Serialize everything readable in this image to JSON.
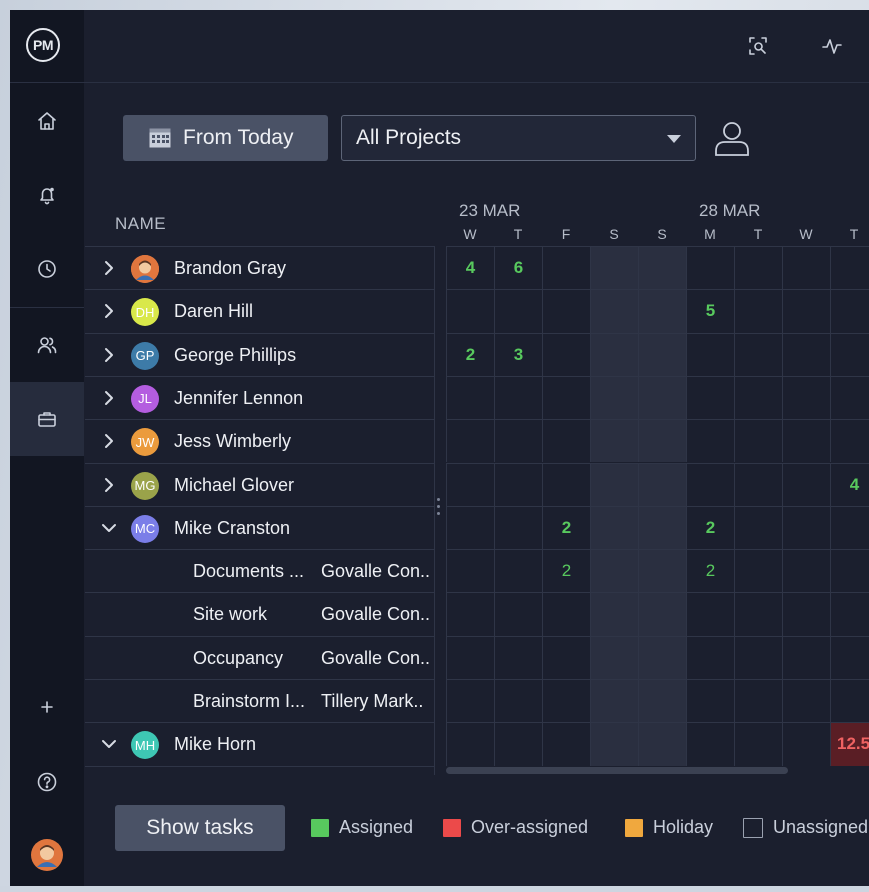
{
  "app": {
    "logo": "PM"
  },
  "sidebar": {
    "items": [
      {
        "icon": "home-icon"
      },
      {
        "icon": "bell-icon"
      },
      {
        "icon": "clock-icon"
      },
      {
        "icon": "users-icon"
      },
      {
        "icon": "briefcase-icon",
        "active": true
      },
      {
        "icon": "plus-icon"
      },
      {
        "icon": "help-icon"
      },
      {
        "icon": "avatar"
      }
    ]
  },
  "topbar": {
    "icons": [
      "zoom-search-icon",
      "activity-icon"
    ]
  },
  "toolbar": {
    "date_button": "From Today",
    "project_select": "All Projects"
  },
  "table": {
    "name_header": "NAME",
    "date_groups": [
      {
        "label": "23 MAR"
      },
      {
        "label": "28 MAR"
      }
    ],
    "days": [
      "W",
      "T",
      "F",
      "S",
      "S",
      "M",
      "T",
      "W",
      "T"
    ]
  },
  "people": [
    {
      "name": "Brandon Gray",
      "initials": "",
      "color": "#e0763e",
      "expanded": false,
      "cells": [
        "4",
        "6",
        "",
        "",
        "",
        "",
        "",
        "",
        ""
      ]
    },
    {
      "name": "Daren Hill",
      "initials": "DH",
      "color": "#d9e84a",
      "expanded": false,
      "cells": [
        "",
        "",
        "",
        "",
        "",
        "5",
        "",
        "",
        ""
      ]
    },
    {
      "name": "George Phillips",
      "initials": "GP",
      "color": "#3d7ba8",
      "expanded": false,
      "cells": [
        "2",
        "3",
        "",
        "",
        "",
        "",
        "",
        "",
        ""
      ]
    },
    {
      "name": "Jennifer Lennon",
      "initials": "JL",
      "color": "#b45de0",
      "expanded": false,
      "cells": [
        "",
        "",
        "",
        "",
        "",
        "",
        "",
        "",
        ""
      ]
    },
    {
      "name": "Jess Wimberly",
      "initials": "JW",
      "color": "#eb9b3d",
      "expanded": false,
      "cells": [
        "",
        "",
        "",
        "",
        "",
        "",
        "",
        "",
        ""
      ]
    },
    {
      "name": "Michael Glover",
      "initials": "MG",
      "color": "#9aa34a",
      "expanded": false,
      "cells": [
        "",
        "",
        "",
        "",
        "",
        "",
        "",
        "",
        "4"
      ]
    },
    {
      "name": "Mike Cranston",
      "initials": "MC",
      "color": "#7b7ee8",
      "expanded": true,
      "cells": [
        "",
        "",
        "2",
        "",
        "",
        "2",
        "",
        "",
        ""
      ]
    }
  ],
  "tasks": [
    {
      "task": "Documents ...",
      "project": "Govalle Con..",
      "cells": [
        "",
        "",
        "2",
        "",
        "",
        "2",
        "",
        "",
        ""
      ]
    },
    {
      "task": "Site work",
      "project": "Govalle Con..",
      "cells": [
        "",
        "",
        "",
        "",
        "",
        "",
        "",
        "",
        ""
      ]
    },
    {
      "task": "Occupancy",
      "project": "Govalle Con..",
      "cells": [
        "",
        "",
        "",
        "",
        "",
        "",
        "",
        "",
        ""
      ]
    },
    {
      "task": "Brainstorm I...",
      "project": "Tillery Mark..",
      "cells": [
        "",
        "",
        "",
        "",
        "",
        "",
        "",
        "",
        ""
      ]
    }
  ],
  "last_person": {
    "name": "Mike Horn",
    "initials": "MH",
    "color": "#3ec7b4",
    "expanded": true,
    "cells": [
      "",
      "",
      "",
      "",
      "",
      "",
      "",
      "",
      "12.5"
    ]
  },
  "footer": {
    "show_tasks": "Show tasks",
    "legend": [
      {
        "label": "Assigned",
        "color": "#58c95e"
      },
      {
        "label": "Over-assigned",
        "color": "#ec4a4a"
      },
      {
        "label": "Holiday",
        "color": "#f0a83e"
      },
      {
        "label": "Unassigned",
        "color": "transparent"
      }
    ]
  }
}
